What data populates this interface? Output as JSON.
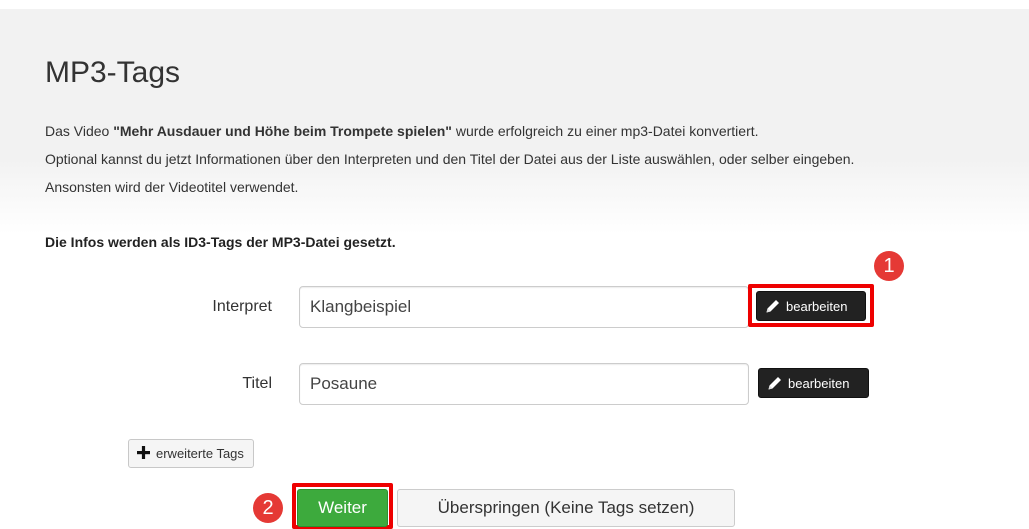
{
  "page": {
    "title": "MP3-Tags"
  },
  "intro": {
    "line1_prefix": "Das Video ",
    "line1_video_title": "\"Mehr Ausdauer und Höhe beim Trompete spielen\"",
    "line1_suffix": " wurde erfolgreich zu einer mp3-Datei konvertiert.",
    "line2": "Optional kannst du jetzt Informationen über den Interpreten und den Titel der Datei aus der Liste auswählen, oder selber eingeben.",
    "line3": "Ansonsten wird der Videotitel verwendet."
  },
  "id3_note": "Die Infos werden als ID3-Tags der MP3-Datei gesetzt.",
  "form": {
    "interpret": {
      "label": "Interpret",
      "value": "Klangbeispiel",
      "edit_label": "bearbeiten"
    },
    "titel": {
      "label": "Titel",
      "value": "Posaune",
      "edit_label": "bearbeiten"
    },
    "extended_tags_label": "erweiterte Tags"
  },
  "actions": {
    "continue_label": "Weiter",
    "skip_label": "Überspringen (Keine Tags setzen)"
  },
  "annotations": {
    "step1": "1",
    "step2": "2",
    "highlight_color": "#ee0000",
    "badge_color": "#e53935"
  },
  "icons": {
    "edit": "pencil-icon",
    "add": "plus-icon"
  },
  "colors": {
    "primary_button": "#3daa3d",
    "dark_button": "#222222",
    "panel_background": "#f2f2f2"
  }
}
